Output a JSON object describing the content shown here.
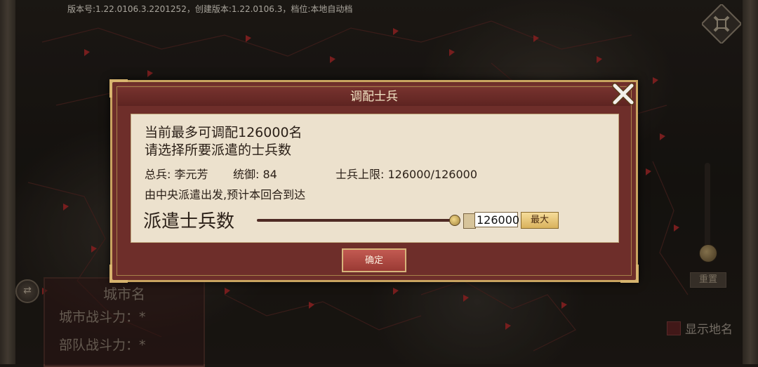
{
  "version_info": "版本号:1.22.0106.3.2201252，创建版本:1.22.0106.3，档位:本地自动档",
  "map": {
    "city_panel": {
      "title": "城市名",
      "city_power": "城市战斗力：*",
      "troop_power": "部队战斗力：*"
    },
    "reset_label": "重置",
    "show_names_label": "显示地名"
  },
  "dialog": {
    "title": "调配士兵",
    "max_line": "当前最多可调配126000名",
    "select_line": "请选择所要派遣的士兵数",
    "general_label": "总兵: 李元芳",
    "command_label": "统御: 84",
    "limit_label": "士兵上限: 126000/126000",
    "dispatch_note": "由中央派遣出发,预计本回合到达",
    "dispatch_label": "派遣士兵数",
    "dispatch_value": "126000",
    "slider_fraction": 1.0,
    "max_button": "最大",
    "confirm_button": "确定"
  },
  "colors": {
    "dialog_frame": "#6e2e2a",
    "dialog_border": "#c9a460",
    "content_bg": "#ece1cd",
    "confirm_button": "#b04a44"
  }
}
